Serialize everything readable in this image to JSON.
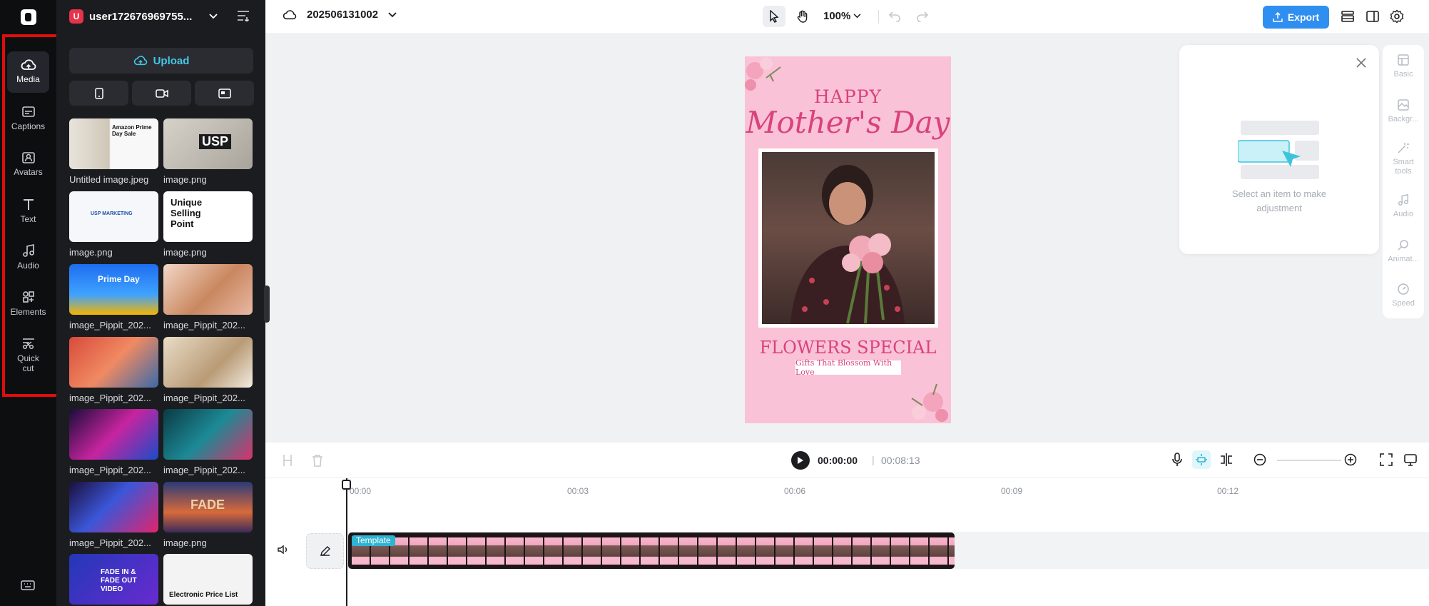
{
  "rail": {
    "items": [
      {
        "label": "Media",
        "active": true
      },
      {
        "label": "Captions"
      },
      {
        "label": "Avatars"
      },
      {
        "label": "Text"
      },
      {
        "label": "Audio"
      },
      {
        "label": "Elements"
      },
      {
        "label": "Quick cut"
      }
    ]
  },
  "account": {
    "initial": "U",
    "name": "user172676969755..."
  },
  "panel": {
    "upload_label": "Upload",
    "media": [
      {
        "name": "Untitled image.jpeg",
        "thumb_text": "Amazon Prime Day Sale"
      },
      {
        "name": "image.png",
        "thumb_text": "USP"
      },
      {
        "name": "image.png",
        "thumb_text": "USP MARKETING"
      },
      {
        "name": "image.png",
        "thumb_text": "Unique Selling Point"
      },
      {
        "name": "image_Pippit_202...",
        "thumb_text": "Prime Day"
      },
      {
        "name": "image_Pippit_202...",
        "thumb_text": ""
      },
      {
        "name": "image_Pippit_202...",
        "thumb_text": ""
      },
      {
        "name": "image_Pippit_202...",
        "thumb_text": ""
      },
      {
        "name": "image_Pippit_202...",
        "thumb_text": ""
      },
      {
        "name": "image_Pippit_202...",
        "thumb_text": ""
      },
      {
        "name": "image_Pippit_202...",
        "thumb_text": ""
      },
      {
        "name": "image.png",
        "thumb_text": "FADE"
      },
      {
        "name": "",
        "thumb_text": "FADE IN & FADE OUT VIDEO"
      },
      {
        "name": "",
        "thumb_text": "Electronic Price List"
      }
    ]
  },
  "topbar": {
    "project_name": "202506131002",
    "zoom": "100%",
    "export_label": "Export"
  },
  "poster": {
    "happy": "HAPPY",
    "mothers_day": "Mother's Day",
    "flowers": "FLOWERS SPECIAL",
    "tagline": "Gifts That Blossom With Love"
  },
  "properties": {
    "hint": "Select an item to make adjustment",
    "tabs": [
      {
        "label": "Basic"
      },
      {
        "label": "Backgr..."
      },
      {
        "label": "Smart tools"
      },
      {
        "label": "Audio"
      },
      {
        "label": "Animat..."
      },
      {
        "label": "Speed"
      }
    ]
  },
  "timeline": {
    "current_time": "00:00:00",
    "separator": "|",
    "total_time": "00:08:13",
    "ticks": [
      "00:00",
      "00:03",
      "00:06",
      "00:09",
      "00:12"
    ],
    "clip_label": "Template"
  },
  "colors": {
    "accent": "#2f8ff0",
    "upload_accent": "#43c8e9",
    "highlight": "#e10d0d",
    "poster_pink": "#fac2d6",
    "poster_text": "#d8437a"
  }
}
